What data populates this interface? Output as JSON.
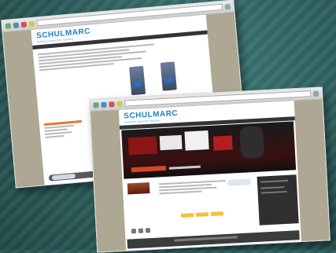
{
  "screenshot_front": {
    "logo": "SCHULMARC",
    "logo_sub": "Intelligent Inspection Solutions"
  },
  "screenshot_back": {
    "logo": "SCHULMARC",
    "logo_sub": "Intelligent Inspection Solutions"
  },
  "colors": {
    "background": "#2f6462",
    "page_margin": "#aea793",
    "logo_blue": "#1f7fc0",
    "accent_orange": "#e47a2c",
    "accent_yellow": "#f3c23b"
  }
}
